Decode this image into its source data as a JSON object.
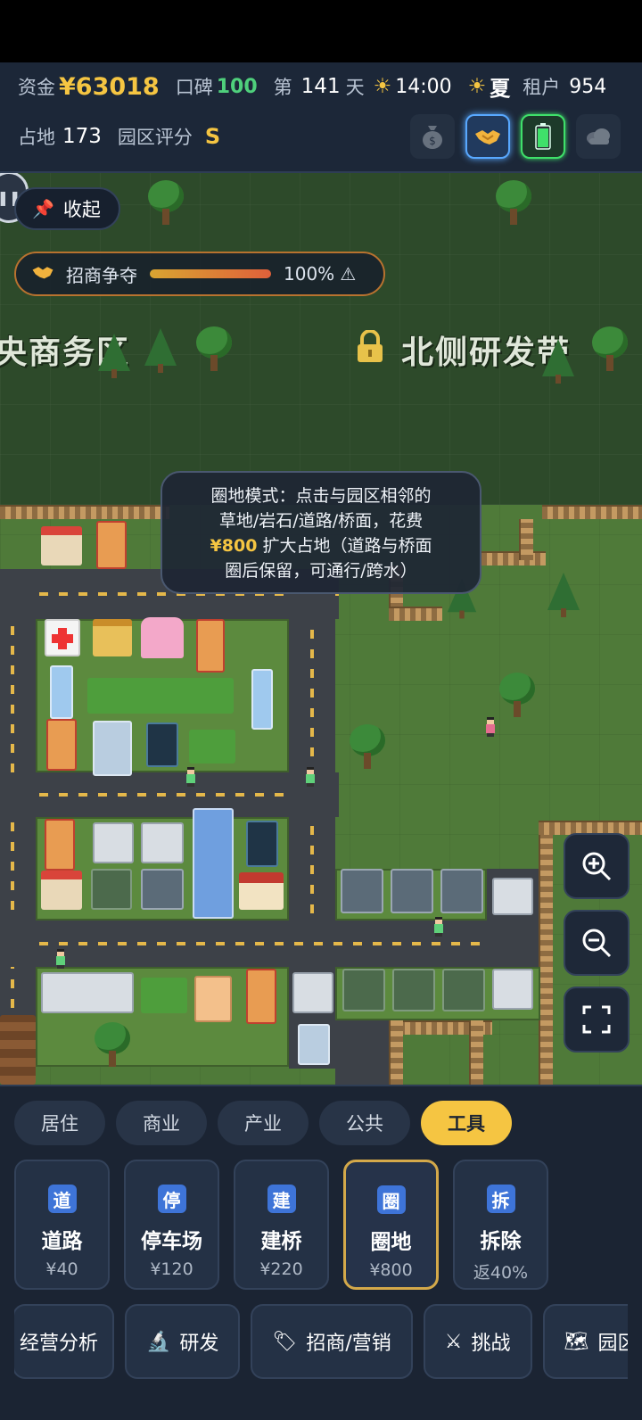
{
  "hud": {
    "money_label": "资金",
    "money_value": "¥63018",
    "reputation_label": "口碑",
    "reputation_value": "100",
    "day_prefix": "第",
    "day_value": "141",
    "day_suffix": "天",
    "time_value": "14:00",
    "season_value": "夏",
    "tenants_label": "租户",
    "tenants_value": "954",
    "land_label": "占地",
    "land_value": "173",
    "rating_label": "园区评分",
    "rating_value": "S",
    "icons": [
      "money-bag-icon",
      "handshake-icon",
      "battery-icon",
      "cloud-icon"
    ]
  },
  "map": {
    "collapse_label": "收起",
    "compete_label": "招商争夺",
    "compete_percent": "100%",
    "compete_level": 1.0,
    "compete_warning": "⚠",
    "zone_left": "央商务区",
    "zone_right": "北侧研发带",
    "tooltip": {
      "line1": "圈地模式：点击与园区相邻的",
      "line2": "草地/岩石/道路/桥面，花费",
      "price": "¥800",
      "line3_rest": " 扩大占地（道路与桥面",
      "line4": "圈后保留，可通行/跨水）"
    }
  },
  "panel": {
    "tabs": [
      {
        "label": "居住",
        "active": false
      },
      {
        "label": "商业",
        "active": false
      },
      {
        "label": "产业",
        "active": false
      },
      {
        "label": "公共",
        "active": false
      },
      {
        "label": "工具",
        "active": true
      }
    ],
    "tools": [
      {
        "badge": "道",
        "name": "道路",
        "cost": "¥40"
      },
      {
        "badge": "停",
        "name": "停车场",
        "cost": "¥120"
      },
      {
        "badge": "建",
        "name": "建桥",
        "cost": "¥220"
      },
      {
        "badge": "圈",
        "name": "圈地",
        "cost": "¥800"
      },
      {
        "badge": "拆",
        "name": "拆除",
        "cost": "返40%"
      }
    ],
    "actions": [
      {
        "icon": "",
        "label": "经营分析"
      },
      {
        "icon": "🔬",
        "label": "研发"
      },
      {
        "icon": "🏷",
        "label": "招商/营销"
      },
      {
        "icon": "⚔",
        "label": "挑战"
      },
      {
        "icon": "🗺",
        "label": "园区"
      }
    ]
  },
  "colors": {
    "accent_gold": "#f5c542",
    "reputation_green": "#4fd07c",
    "badge_blue": "#3e74d8",
    "panel_bg": "#1b2433"
  }
}
